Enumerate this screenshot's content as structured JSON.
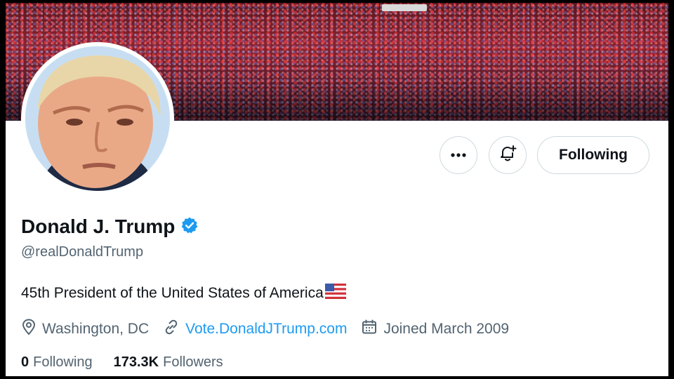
{
  "profile": {
    "display_name": "Donald J. Trump",
    "verified_icon": "verified-badge-icon",
    "handle": "@realDonaldTrump",
    "bio": "45th President of the United States of America",
    "location": "Washington, DC",
    "website": "Vote.DonaldJTrump.com",
    "joined": "Joined March 2009",
    "following_count": "0",
    "following_label": "Following",
    "followers_count": "173.3K",
    "followers_label": "Followers"
  },
  "actions": {
    "more_icon": "more-options-icon",
    "notify_icon": "notification-bell-plus-icon",
    "follow_label": "Following"
  },
  "icons": {
    "location": "location-pin-icon",
    "link": "link-icon",
    "calendar": "calendar-icon",
    "flag": "us-flag-icon"
  },
  "colors": {
    "verified": "#1d9bf0",
    "link": "#1d9bf0",
    "text_primary": "#0f1419",
    "text_secondary": "#536471",
    "border": "#cfd9de"
  }
}
